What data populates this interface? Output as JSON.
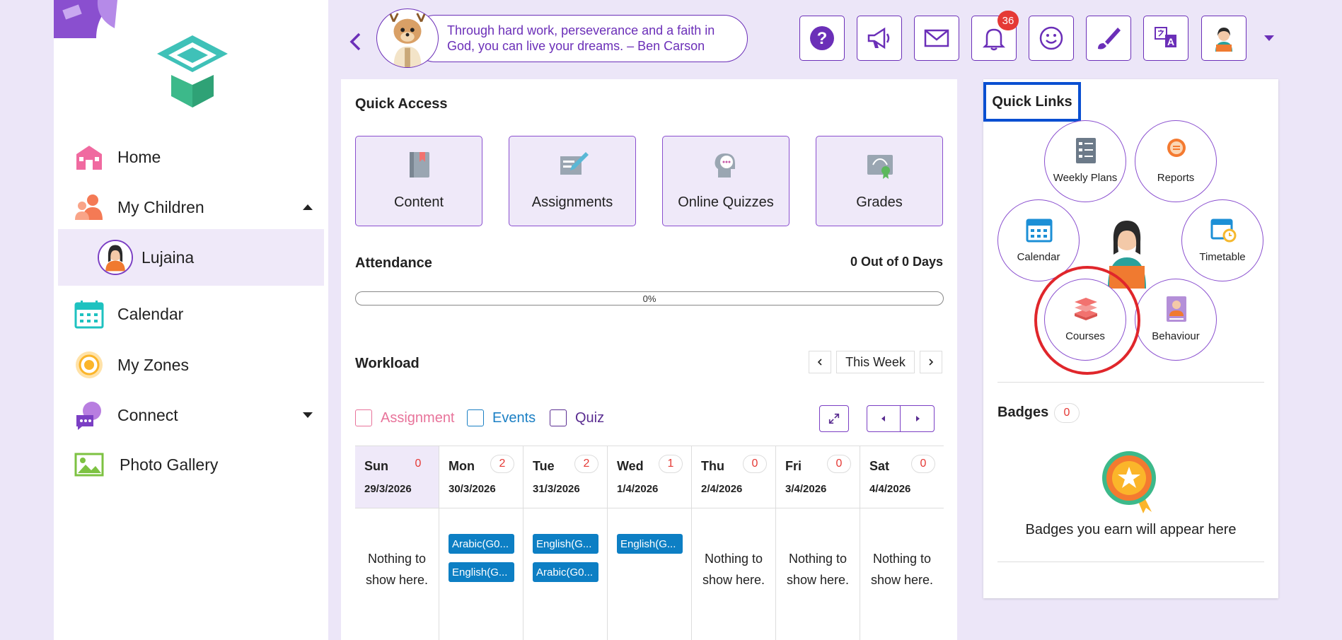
{
  "colors": {
    "accent": "#6b2fb8",
    "highlight_box": "#0a4fd1",
    "highlight_ring": "#e0262b",
    "event": "#0d7fc4",
    "badge_red": "#e53935"
  },
  "sidebar": {
    "items": [
      {
        "label": "Home",
        "icon": "home-icon"
      },
      {
        "label": "My Children",
        "icon": "children-icon"
      },
      {
        "label": "Calendar",
        "icon": "calendar-icon"
      },
      {
        "label": "My Zones",
        "icon": "zones-icon"
      },
      {
        "label": "Connect",
        "icon": "connect-icon"
      },
      {
        "label": "Photo Gallery",
        "icon": "gallery-icon"
      }
    ],
    "child": {
      "label": "Lujaina"
    }
  },
  "header": {
    "quote": "Through hard work, perseverance and a faith in God, you can live your dreams. – Ben Carson",
    "notifications_count": "36",
    "buttons": [
      "help-icon",
      "announcement-icon",
      "mail-icon",
      "bell-icon",
      "smiley-icon",
      "brush-icon",
      "translate-icon",
      "profile-avatar"
    ]
  },
  "quick_access": {
    "title": "Quick Access",
    "items": [
      {
        "label": "Content",
        "icon": "book-icon"
      },
      {
        "label": "Assignments",
        "icon": "assignment-icon"
      },
      {
        "label": "Online Quizzes",
        "icon": "quiz-icon"
      },
      {
        "label": "Grades",
        "icon": "grades-icon"
      }
    ]
  },
  "attendance": {
    "title": "Attendance",
    "days": "0 Out of 0 Days",
    "percent_label": "0%",
    "percent": 0
  },
  "workload": {
    "title": "Workload",
    "week_label": "This Week",
    "legend": [
      {
        "label": "Assignment",
        "color": "#e8739a"
      },
      {
        "label": "Events",
        "color": "#1a7fc4"
      },
      {
        "label": "Quiz",
        "color": "#5a2d91"
      }
    ],
    "days": [
      {
        "name": "Sun",
        "count": "0",
        "date": "29/3/2026",
        "events": [],
        "empty": "Nothing to show here."
      },
      {
        "name": "Mon",
        "count": "2",
        "date": "30/3/2026",
        "events": [
          "Arabic(G0...",
          "English(G..."
        ],
        "empty": ""
      },
      {
        "name": "Tue",
        "count": "2",
        "date": "31/3/2026",
        "events": [
          "English(G...",
          "Arabic(G0..."
        ],
        "empty": ""
      },
      {
        "name": "Wed",
        "count": "1",
        "date": "1/4/2026",
        "events": [
          "English(G..."
        ],
        "empty": ""
      },
      {
        "name": "Thu",
        "count": "0",
        "date": "2/4/2026",
        "events": [],
        "empty": "Nothing to show here."
      },
      {
        "name": "Fri",
        "count": "0",
        "date": "3/4/2026",
        "events": [],
        "empty": "Nothing to show here."
      },
      {
        "name": "Sat",
        "count": "0",
        "date": "4/4/2026",
        "events": [],
        "empty": "Nothing to show here."
      }
    ]
  },
  "quick_links": {
    "title": "Quick Links",
    "items": [
      {
        "label": "Weekly Plans",
        "icon": "weekly-plans-icon"
      },
      {
        "label": "Reports",
        "icon": "reports-icon"
      },
      {
        "label": "Calendar",
        "icon": "calendar-icon"
      },
      {
        "label": "Timetable",
        "icon": "timetable-icon"
      },
      {
        "label": "Courses",
        "icon": "courses-icon"
      },
      {
        "label": "Behaviour",
        "icon": "behaviour-icon"
      }
    ]
  },
  "badges": {
    "title": "Badges",
    "count": "0",
    "empty": "Badges you earn will appear here"
  }
}
